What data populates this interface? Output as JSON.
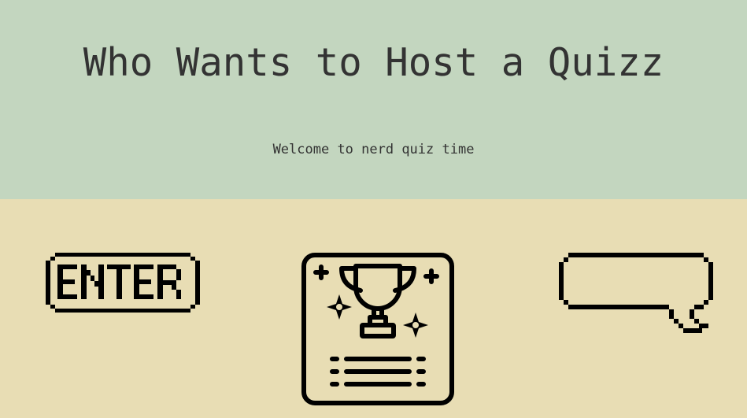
{
  "header": {
    "title": "Who Wants to Host a Quizz",
    "subtitle": "Welcome to nerd quiz time"
  },
  "main": {
    "icons": [
      {
        "name": "enter-icon",
        "label": "ENTER"
      },
      {
        "name": "trophy-certificate-icon"
      },
      {
        "name": "speech-bubble-icon"
      }
    ]
  },
  "colors": {
    "header_bg": "#c3d6bf",
    "body_bg": "#e8ddb4",
    "text": "#333333",
    "icon_stroke": "#000000"
  }
}
